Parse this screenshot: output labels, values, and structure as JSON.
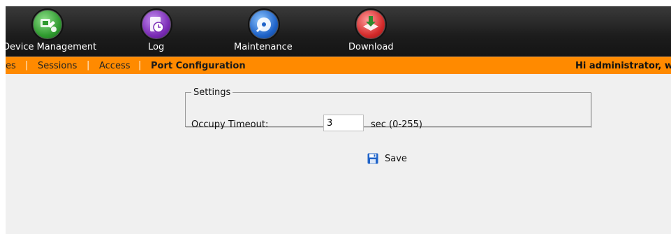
{
  "toolbar": {
    "items": [
      {
        "label": "Device Management",
        "icon": "device-management-icon",
        "color": "#3aa83a"
      },
      {
        "label": "Log",
        "icon": "log-icon",
        "color": "#7a2bb5"
      },
      {
        "label": "Maintenance",
        "icon": "maintenance-icon",
        "color": "#1f63c8"
      },
      {
        "label": "Download",
        "icon": "download-icon",
        "color": "#d32a2a"
      }
    ]
  },
  "nav": {
    "items": [
      {
        "label": "es"
      },
      {
        "label": "Sessions"
      },
      {
        "label": "Access"
      },
      {
        "label": "Port Configuration"
      }
    ],
    "separator": "|",
    "greeting": "Hi administrator, w"
  },
  "settings": {
    "legend": "Settings",
    "occupy_timeout_label": "Occupy Timeout:",
    "occupy_timeout_value": "3",
    "occupy_timeout_unit": "sec (0-255)"
  },
  "actions": {
    "save_label": "Save"
  },
  "colors": {
    "nav_bar": "#ff8a00",
    "toolbar_bg": "#1c1c1c",
    "content_bg": "#f0f0f0"
  }
}
